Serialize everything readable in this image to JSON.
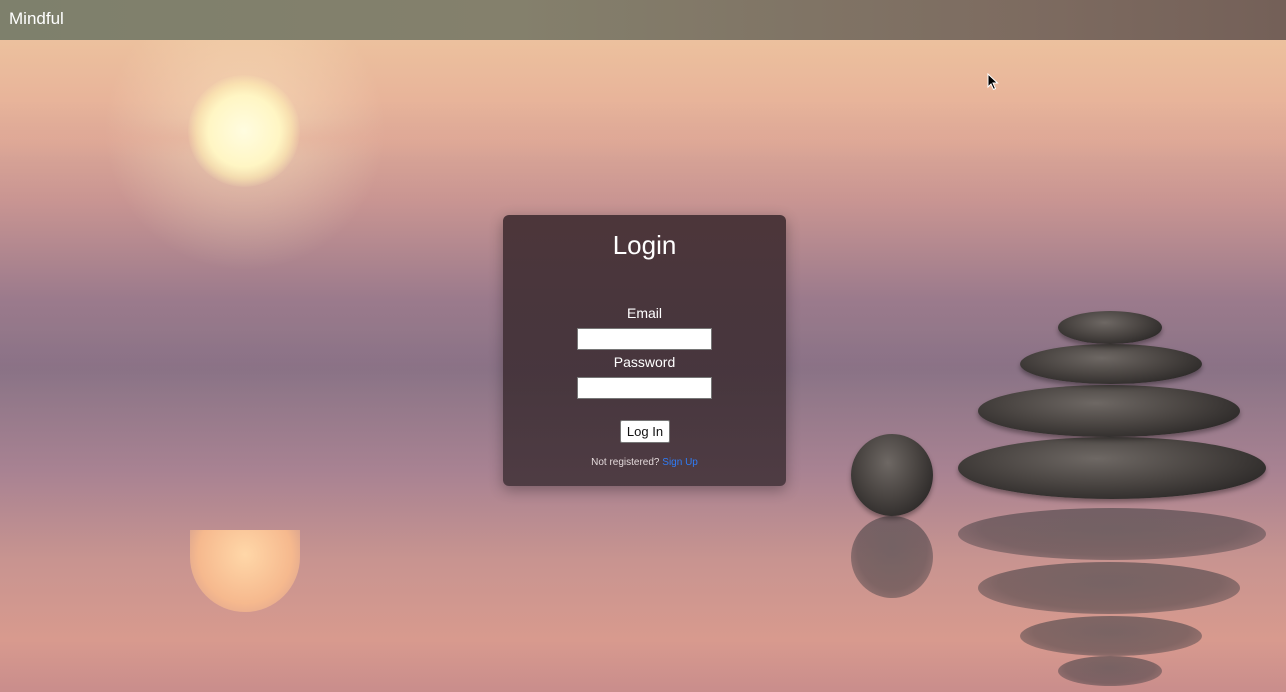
{
  "navbar": {
    "brand": "Mindful"
  },
  "login": {
    "title": "Login",
    "email_label": "Email",
    "email_value": "",
    "password_label": "Password",
    "password_value": "",
    "submit_label": "Log In",
    "signup_prompt": "Not registered?",
    "signup_link": "Sign Up"
  },
  "colors": {
    "navbar_bg": "#7e806c",
    "card_bg": "#3c2a2e",
    "link": "#2f7cf6",
    "text": "#ffffff"
  },
  "icons": {
    "cursor": "mouse-pointer-icon"
  }
}
